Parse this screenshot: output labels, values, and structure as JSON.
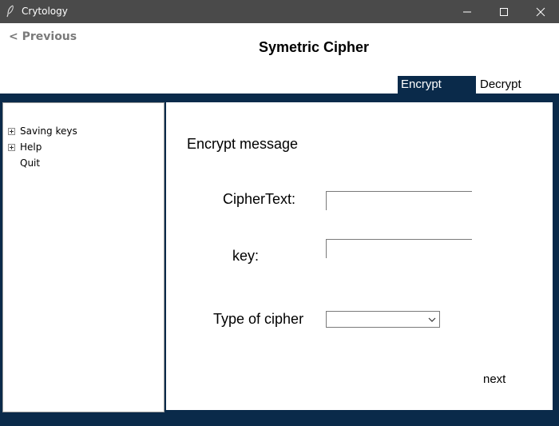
{
  "window": {
    "title": "Crytology",
    "controls": [
      "minimize-icon",
      "maximize-icon",
      "close-icon"
    ]
  },
  "header": {
    "previous_label": "< Previous",
    "page_title": "Symetric Cipher"
  },
  "tabs": [
    {
      "label": "Encrypt",
      "active": true
    },
    {
      "label": "Decrypt",
      "active": false
    }
  ],
  "sidebar": {
    "items": [
      {
        "label": "Saving keys",
        "expandable": true
      },
      {
        "label": "Help",
        "expandable": true
      },
      {
        "label": "Quit",
        "expandable": false
      }
    ]
  },
  "main": {
    "section_title": "Encrypt message",
    "ciphertext_label": "CipherText:",
    "ciphertext_value": "",
    "key_label": "key:",
    "key_value": "",
    "cipher_type_label": "Type of cipher",
    "cipher_type_selected": "",
    "next_label": "next"
  },
  "colors": {
    "titlebar": "#4a4a4a",
    "frame": "#0a2a4a",
    "active_tab": "#0a2a4a",
    "previous_link": "#7a7a7a"
  }
}
